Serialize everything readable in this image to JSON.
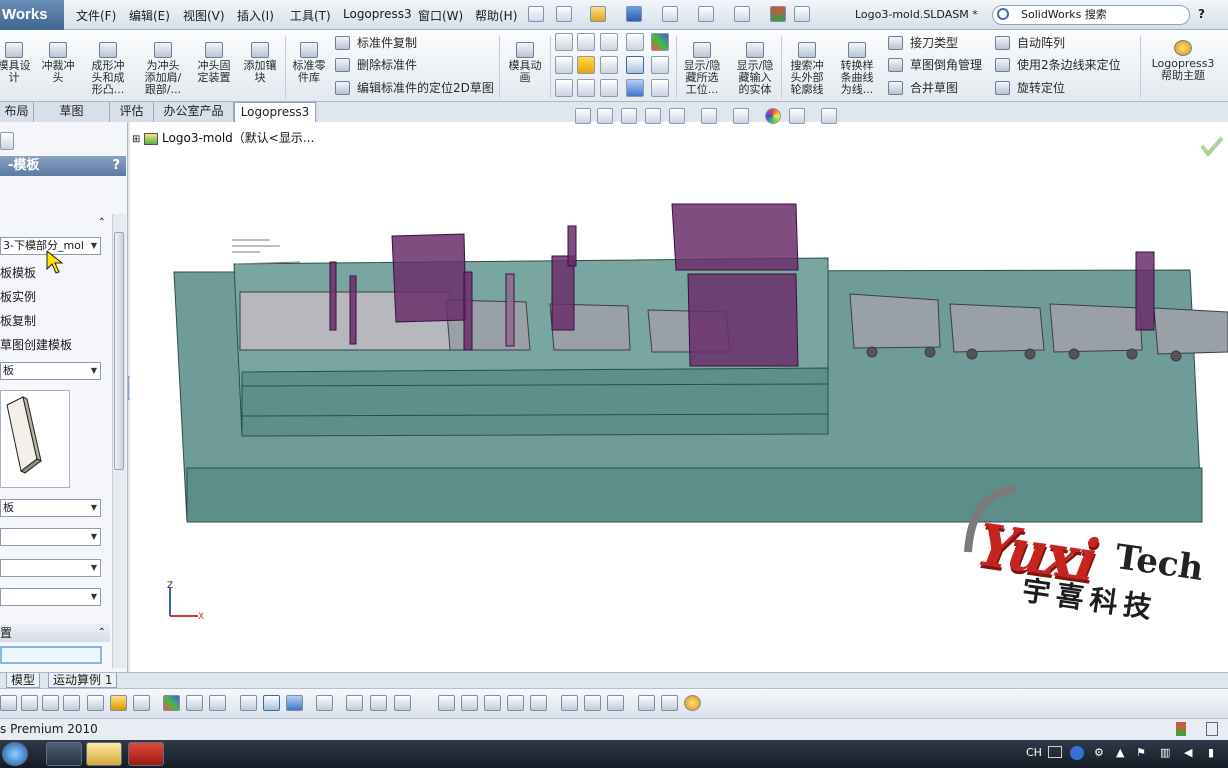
{
  "app": {
    "brand": "Works",
    "document_title": "Logo3-mold.SLDASM *",
    "search_placeholder": "SolidWorks 搜索",
    "help_icon": "?"
  },
  "menu": [
    "文件(F)",
    "编辑(E)",
    "视图(V)",
    "插入(I)",
    "工具(T)",
    "Logopress3",
    "窗口(W)",
    "帮助(H)"
  ],
  "ribbon": {
    "big_buttons": [
      {
        "label": "模具设\n计"
      },
      {
        "label": "冲裁冲\n头"
      },
      {
        "label": "成形冲\n头和成\n形凸..."
      },
      {
        "label": "为冲头\n添加肩/\n跟部/..."
      },
      {
        "label": "冲头固\n定装置"
      },
      {
        "label": "添加镶\n块"
      },
      {
        "label": "标准零\n件库"
      },
      {
        "label": "模具动\n画"
      },
      {
        "label": "显示/隐\n藏所选\n工位..."
      },
      {
        "label": "显示/隐\n藏输入\n的实体"
      },
      {
        "label": "搜索冲\n头外部\n轮廓线"
      },
      {
        "label": "转换样\n条曲线\n为线..."
      },
      {
        "label": "Logopress3\n帮助主题"
      }
    ],
    "small_buttons": [
      {
        "label": "标准件复制"
      },
      {
        "label": "删除标准件"
      },
      {
        "label": "编辑标准件的定位2D草图"
      },
      {
        "label": "接刀类型"
      },
      {
        "label": "草图倒角管理"
      },
      {
        "label": "合并草图"
      },
      {
        "label": "自动阵列"
      },
      {
        "label": "使用2条边线来定位"
      },
      {
        "label": "旋转定位"
      }
    ]
  },
  "tabs": [
    "布局",
    "草图",
    "评估",
    "办公室产品",
    "Logopress3"
  ],
  "left_panel": {
    "title": "-模板",
    "help": "?",
    "dropdown1": "3-下模部分_mol",
    "options": [
      "板模板",
      "板实例",
      "板复制",
      "草图创建模板"
    ],
    "dropdown2": "板",
    "dropdown3": "板",
    "section2": "置"
  },
  "tree": {
    "root": "Logo3-mold（默认<显示..."
  },
  "model_tabs": [
    "模型",
    "运动算例 1"
  ],
  "status": {
    "text": "s Premium 2010"
  },
  "tray": {
    "lang": "CH"
  },
  "watermark": {
    "logo": "Yuxi",
    "tech": "Tech",
    "cn": "宇喜科技"
  },
  "axes": {
    "z": "Z",
    "x": "X"
  },
  "colors": {
    "plate": "#6f9c98",
    "plate_dark": "#4f7e7a",
    "punch": "#6a2e6a",
    "watermark_red": "#c7241f"
  }
}
